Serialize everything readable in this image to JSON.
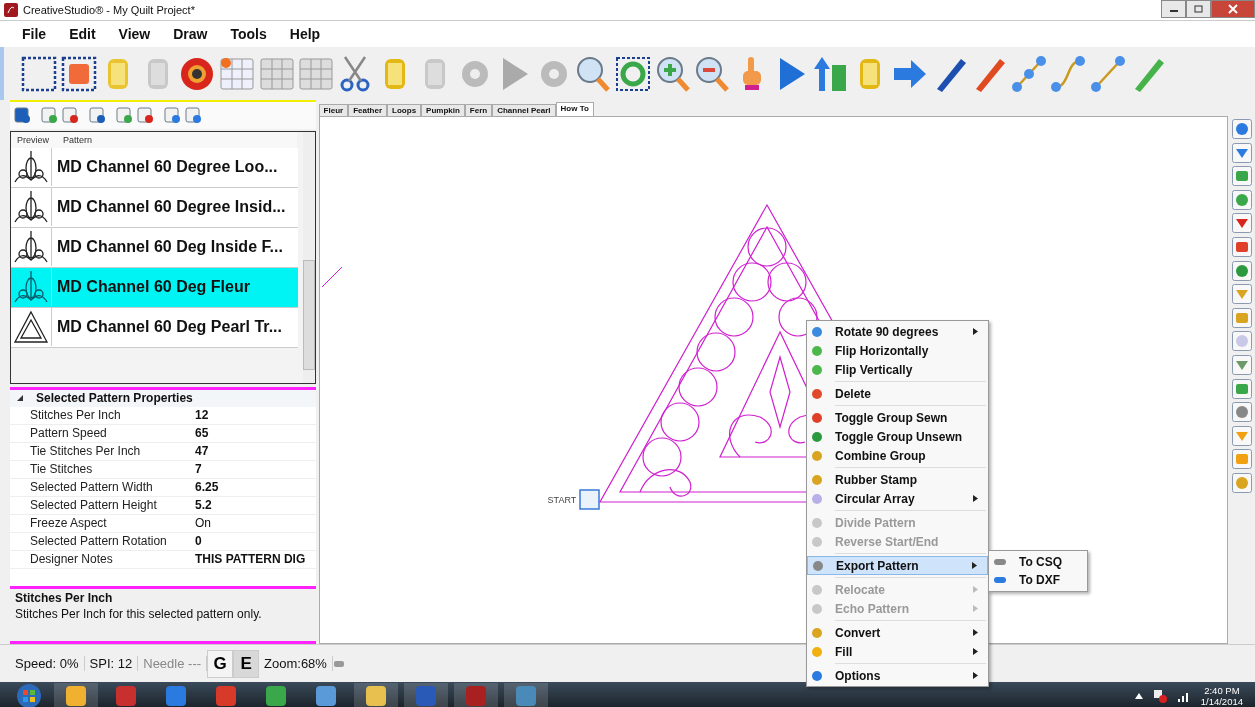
{
  "window": {
    "title": "CreativeStudio® - My Quilt Project*"
  },
  "menu": [
    "File",
    "Edit",
    "View",
    "Draw",
    "Tools",
    "Help"
  ],
  "tabs": [
    {
      "label": "Fleur",
      "selected": false
    },
    {
      "label": "Feather",
      "selected": false
    },
    {
      "label": "Loops",
      "selected": false
    },
    {
      "label": "Pumpkin",
      "selected": false
    },
    {
      "label": "Fern",
      "selected": false
    },
    {
      "label": "Channel Pearl",
      "selected": false
    },
    {
      "label": "How To",
      "selected": true
    }
  ],
  "pattern_list": {
    "columns": [
      "Preview",
      "Pattern"
    ],
    "rows": [
      {
        "name": "MD Channel 60 Degree Loo...",
        "selected": false
      },
      {
        "name": "MD Channel 60 Degree Insid...",
        "selected": false
      },
      {
        "name": "MD Channel 60 Deg Inside F...",
        "selected": false
      },
      {
        "name": "MD Channel 60 Deg Fleur",
        "selected": true
      },
      {
        "name": "MD Channel 60 Deg Pearl Tr...",
        "selected": false
      }
    ]
  },
  "properties": {
    "heading": "Selected Pattern Properties",
    "expanded": true,
    "rows": [
      {
        "name": "Stitches Per Inch",
        "value": "12",
        "bold": true
      },
      {
        "name": "Pattern Speed",
        "value": "65",
        "bold": true
      },
      {
        "name": "Tie Stitches Per Inch",
        "value": "47",
        "bold": true
      },
      {
        "name": "Tie Stitches",
        "value": "7",
        "bold": true
      },
      {
        "name": "Selected Pattern Width",
        "value": "6.25",
        "bold": true
      },
      {
        "name": "Selected Pattern Height",
        "value": "5.2",
        "bold": true
      },
      {
        "name": "Freeze Aspect",
        "value": "On",
        "bold": false
      },
      {
        "name": "Selected Pattern Rotation",
        "value": "0",
        "bold": true
      },
      {
        "name": "Designer Notes",
        "value": "THIS PATTERN DIG",
        "bold": true
      }
    ]
  },
  "help": {
    "title": "Stitches Per Inch",
    "text": "Stitches Per Inch for this selected pattern only."
  },
  "canvas": {
    "start_label": "START"
  },
  "context_menu": [
    {
      "kind": "item",
      "label": "Rotate 90 degrees",
      "disabled": false,
      "submenu": true,
      "selected": false
    },
    {
      "kind": "item",
      "label": "Flip Horizontally",
      "disabled": false,
      "submenu": false,
      "selected": false
    },
    {
      "kind": "item",
      "label": "Flip Vertically",
      "disabled": false,
      "submenu": false,
      "selected": false
    },
    {
      "kind": "separator"
    },
    {
      "kind": "item",
      "label": "Delete",
      "disabled": false,
      "submenu": false,
      "selected": false
    },
    {
      "kind": "separator"
    },
    {
      "kind": "item",
      "label": "Toggle Group Sewn",
      "disabled": false,
      "submenu": false,
      "selected": false
    },
    {
      "kind": "item",
      "label": "Toggle Group Unsewn",
      "disabled": false,
      "submenu": false,
      "selected": false
    },
    {
      "kind": "item",
      "label": "Combine Group",
      "disabled": false,
      "submenu": false,
      "selected": false
    },
    {
      "kind": "separator"
    },
    {
      "kind": "item",
      "label": "Rubber Stamp",
      "disabled": false,
      "submenu": false,
      "selected": false
    },
    {
      "kind": "item",
      "label": "Circular Array",
      "disabled": false,
      "submenu": true,
      "selected": false
    },
    {
      "kind": "separator"
    },
    {
      "kind": "item",
      "label": "Divide Pattern",
      "disabled": true,
      "submenu": false,
      "selected": false
    },
    {
      "kind": "item",
      "label": "Reverse Start/End",
      "disabled": true,
      "submenu": false,
      "selected": false
    },
    {
      "kind": "separator"
    },
    {
      "kind": "item",
      "label": "Export Pattern",
      "disabled": false,
      "submenu": true,
      "selected": true
    },
    {
      "kind": "separator"
    },
    {
      "kind": "item",
      "label": "Relocate",
      "disabled": true,
      "submenu": true,
      "selected": false
    },
    {
      "kind": "item",
      "label": "Echo Pattern",
      "disabled": true,
      "submenu": true,
      "selected": false
    },
    {
      "kind": "separator"
    },
    {
      "kind": "item",
      "label": "Convert",
      "disabled": false,
      "submenu": true,
      "selected": false
    },
    {
      "kind": "item",
      "label": "Fill",
      "disabled": false,
      "submenu": true,
      "selected": false
    },
    {
      "kind": "separator"
    },
    {
      "kind": "item",
      "label": "Options",
      "disabled": false,
      "submenu": true,
      "selected": false
    }
  ],
  "submenu": [
    "To CSQ",
    "To DXF"
  ],
  "status_bar": [
    {
      "kind": "text",
      "text": "Speed: 0%"
    },
    {
      "kind": "text",
      "text": "SPI: 12"
    },
    {
      "kind": "dim",
      "text": "Needle ---"
    },
    {
      "kind": "toggle",
      "text": "G",
      "selected": false
    },
    {
      "kind": "toggle",
      "text": "E",
      "selected": true
    },
    {
      "kind": "text",
      "text": "Zoom:68%"
    }
  ],
  "taskbar": {
    "time": "2:40 PM",
    "date": "1/14/2014"
  }
}
